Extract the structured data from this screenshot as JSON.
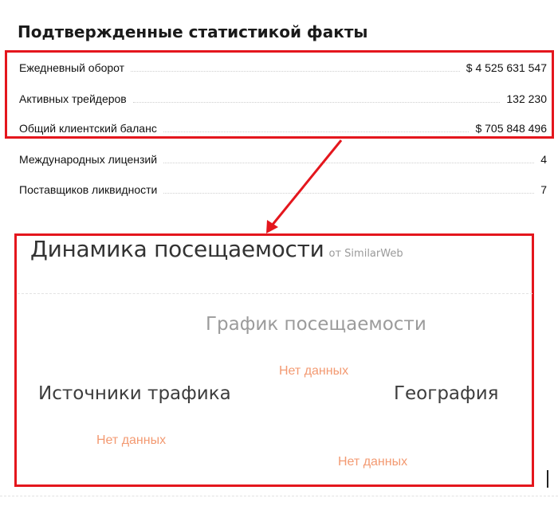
{
  "facts": {
    "title": "Подтвержденные статистикой факты",
    "rows": [
      {
        "label": "Ежедневный оборот",
        "value": "$ 4 525 631 547"
      },
      {
        "label": "Активных трейдеров",
        "value": "132 230"
      },
      {
        "label": "Общий клиентский баланс",
        "value": "$ 705 848 496"
      },
      {
        "label": "Международных лицензий",
        "value": "4"
      },
      {
        "label": "Поставщиков ликвидности",
        "value": "7"
      }
    ]
  },
  "traffic": {
    "title": "Динамика посещаемости",
    "source": "от SimilarWeb",
    "graph_title": "График посещаемости",
    "graph_status": "Нет данных",
    "sources_title": "Источники трафика",
    "sources_status": "Нет данных",
    "geo_title": "География",
    "geo_status": "Нет данных"
  },
  "colors": {
    "highlight": "#e4161d",
    "no_data": "#f39a72"
  }
}
